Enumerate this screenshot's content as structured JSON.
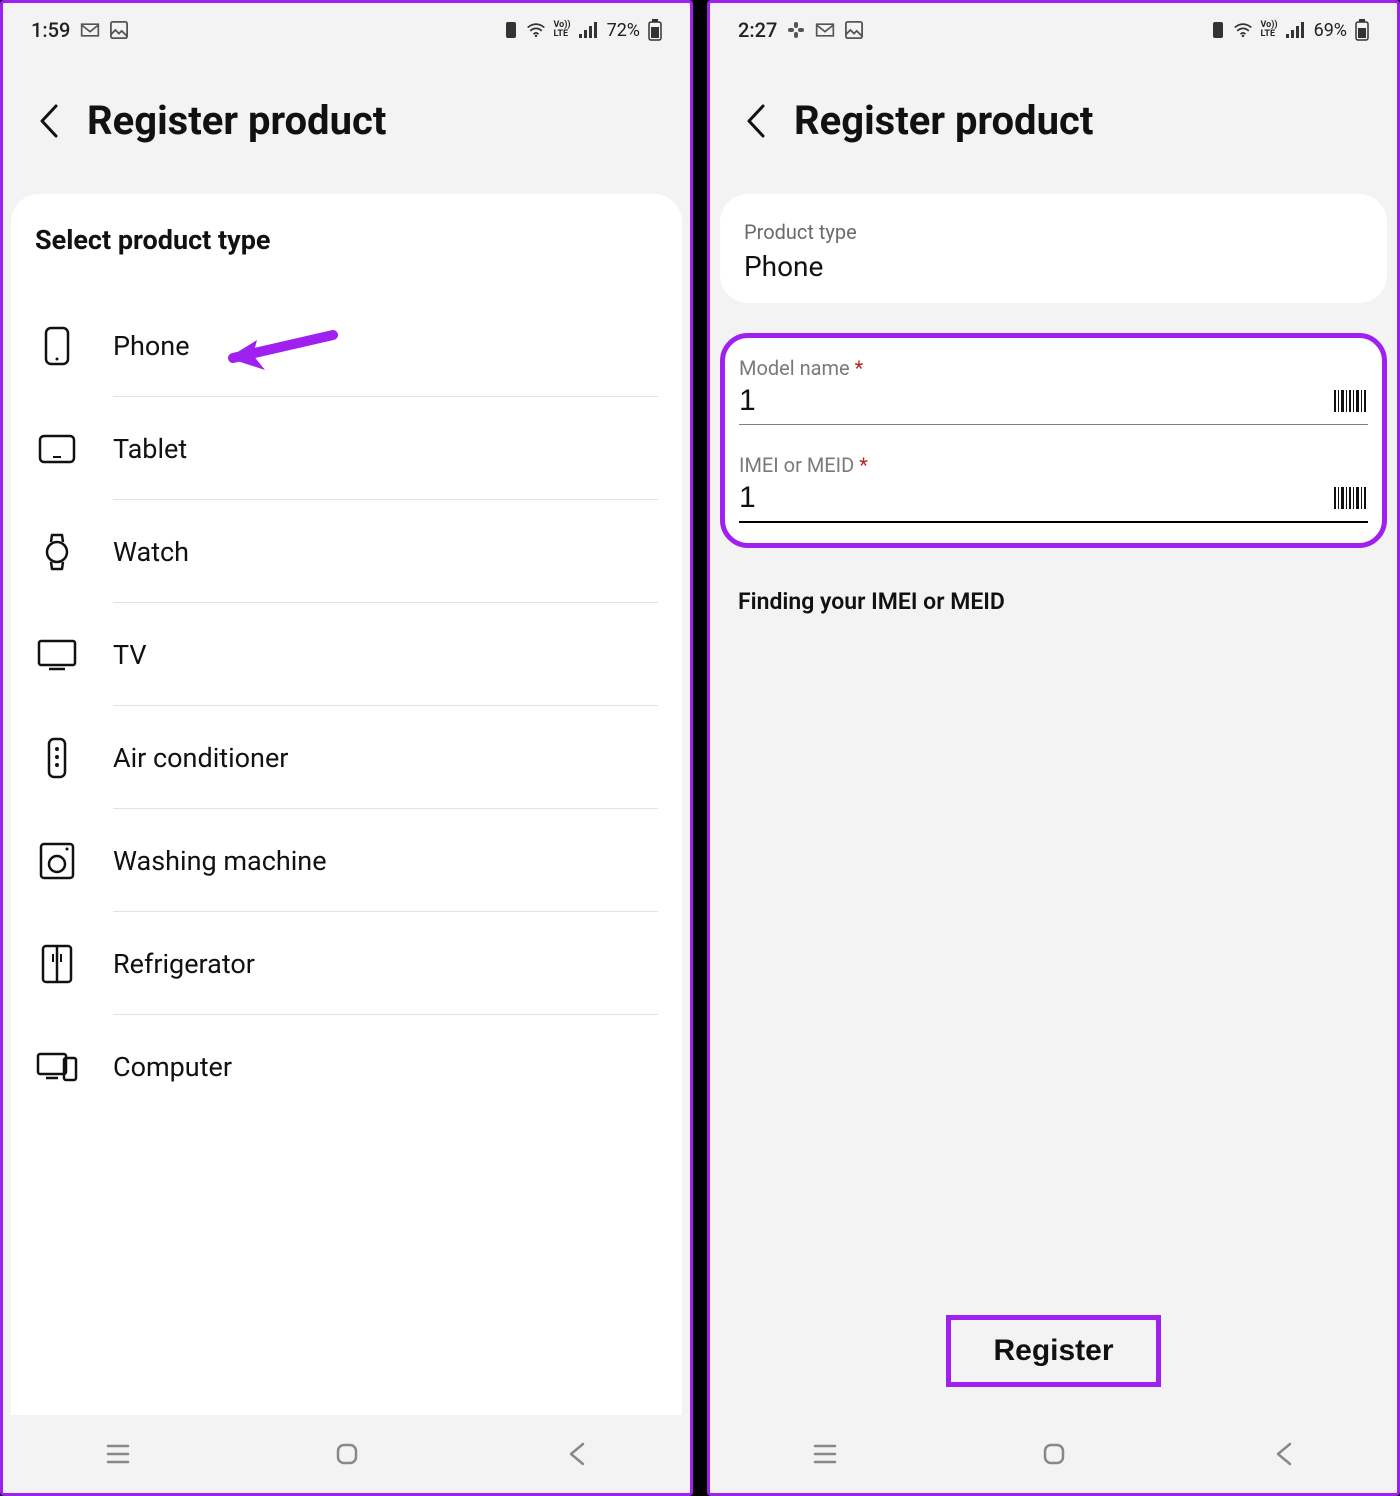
{
  "left": {
    "status": {
      "time": "1:59",
      "battery": "72%"
    },
    "header_title": "Register product",
    "section_title": "Select product type",
    "products": [
      {
        "name": "Phone"
      },
      {
        "name": "Tablet"
      },
      {
        "name": "Watch"
      },
      {
        "name": "TV"
      },
      {
        "name": "Air conditioner"
      },
      {
        "name": "Washing machine"
      },
      {
        "name": "Refrigerator"
      },
      {
        "name": "Computer"
      }
    ]
  },
  "right": {
    "status": {
      "time": "2:27",
      "battery": "69%"
    },
    "header_title": "Register product",
    "type_label": "Product type",
    "type_value": "Phone",
    "model_label": "Model name",
    "model_value": "1",
    "imei_label": "IMEI or MEID",
    "imei_value": "1",
    "hint": "Finding your IMEI or MEID",
    "register_label": "Register",
    "required_mark": "*"
  }
}
